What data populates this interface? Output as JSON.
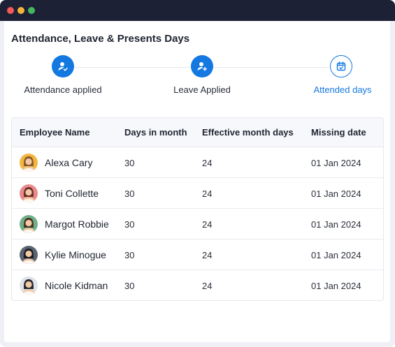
{
  "window": {
    "title": ""
  },
  "page": {
    "title": "Attendance, Leave & Presents Days"
  },
  "stepper": {
    "steps": [
      {
        "label": "Attendance applied",
        "icon": "user-check-icon",
        "state": "completed"
      },
      {
        "label": "Leave Applied",
        "icon": "user-add-icon",
        "state": "completed"
      },
      {
        "label": "Attended days",
        "icon": "calendar-check-icon",
        "state": "active"
      }
    ]
  },
  "table": {
    "columns": [
      "Employee Name",
      "Days in month",
      "Effective month days",
      "Missing date"
    ],
    "rows": [
      {
        "name": "Alexa Cary",
        "days": "30",
        "effective": "24",
        "missing": "01 Jan 2024",
        "avatar_bg": "#f3b63f",
        "avatar_hair": "#8a5a2b"
      },
      {
        "name": "Toni Collette",
        "days": "30",
        "effective": "24",
        "missing": "01 Jan 2024",
        "avatar_bg": "#e98a8a",
        "avatar_hair": "#6b2f2a"
      },
      {
        "name": "Margot Robbie",
        "days": "30",
        "effective": "24",
        "missing": "01 Jan 2024",
        "avatar_bg": "#6fb08a",
        "avatar_hair": "#4a3422"
      },
      {
        "name": "Kylie Minogue",
        "days": "30",
        "effective": "24",
        "missing": "01 Jan 2024",
        "avatar_bg": "#5a6473",
        "avatar_hair": "#1d1d22"
      },
      {
        "name": "Nicole Kidman",
        "days": "30",
        "effective": "24",
        "missing": "01 Jan 2024",
        "avatar_bg": "#dfe3ea",
        "avatar_hair": "#2a2a2e"
      }
    ]
  },
  "colors": {
    "accent": "#1378e0",
    "titlebar": "#1c2135"
  }
}
